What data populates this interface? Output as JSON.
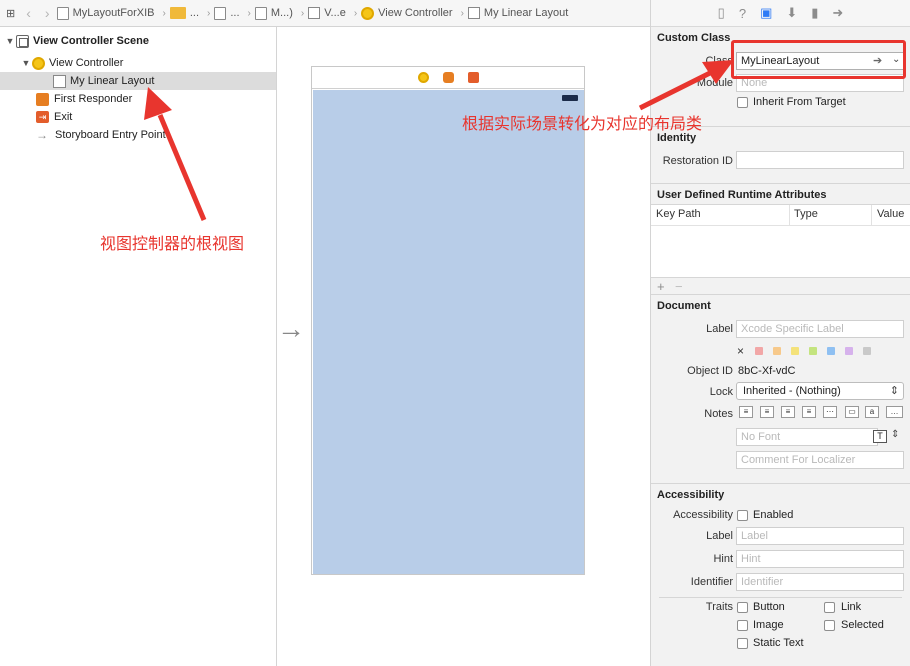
{
  "breadcrumb": [
    "MyLayoutForXIB",
    "...",
    "...",
    "M...)",
    "V...e",
    "View Controller",
    "My Linear Layout"
  ],
  "outline": {
    "scene": "View Controller Scene",
    "controller": "View Controller",
    "root_view": "My Linear Layout",
    "first_responder": "First Responder",
    "exit": "Exit",
    "entry": "Storyboard Entry Point"
  },
  "inspector": {
    "custom_class": {
      "header": "Custom Class",
      "class_label": "Class",
      "class_value": "MyLinearLayout",
      "module_label": "Module",
      "module_placeholder": "None",
      "inherit_label": "Inherit From Target"
    },
    "identity": {
      "header": "Identity",
      "restoration_label": "Restoration ID",
      "restoration_value": ""
    },
    "runtime": {
      "header": "User Defined Runtime Attributes",
      "col_keypath": "Key Path",
      "col_type": "Type",
      "col_value": "Value",
      "add": "+",
      "remove": "−"
    },
    "document": {
      "header": "Document",
      "label_label": "Label",
      "label_placeholder": "Xcode Specific Label",
      "clear": "×",
      "object_id_label": "Object ID",
      "object_id_value": "8bC-Xf-vdC",
      "lock_label": "Lock",
      "lock_value": "Inherited - (Nothing)",
      "notes_label": "Notes",
      "font_placeholder": "No Font",
      "comment_placeholder": "Comment For Localizer"
    },
    "accessibility": {
      "header": "Accessibility",
      "accessibility_label": "Accessibility",
      "enabled_label": "Enabled",
      "label_label": "Label",
      "label_placeholder": "Label",
      "hint_label": "Hint",
      "hint_placeholder": "Hint",
      "identifier_label": "Identifier",
      "identifier_placeholder": "Identifier",
      "traits_label": "Traits",
      "traits": [
        "Button",
        "Link",
        "Image",
        "Selected",
        "Static Text"
      ]
    }
  },
  "annotations": {
    "class_note": "根据实际场景转化为对应的布局类",
    "root_note": "视图控制器的根视图"
  },
  "colors": {
    "annotation_red": "#e8352e",
    "view_fill": "#b8cde8",
    "swatches": [
      "#f2a7a7",
      "#f7c98b",
      "#f4e27a",
      "#c4e47f",
      "#8fc0f2",
      "#d6b2ec",
      "#c9c9c9"
    ]
  }
}
